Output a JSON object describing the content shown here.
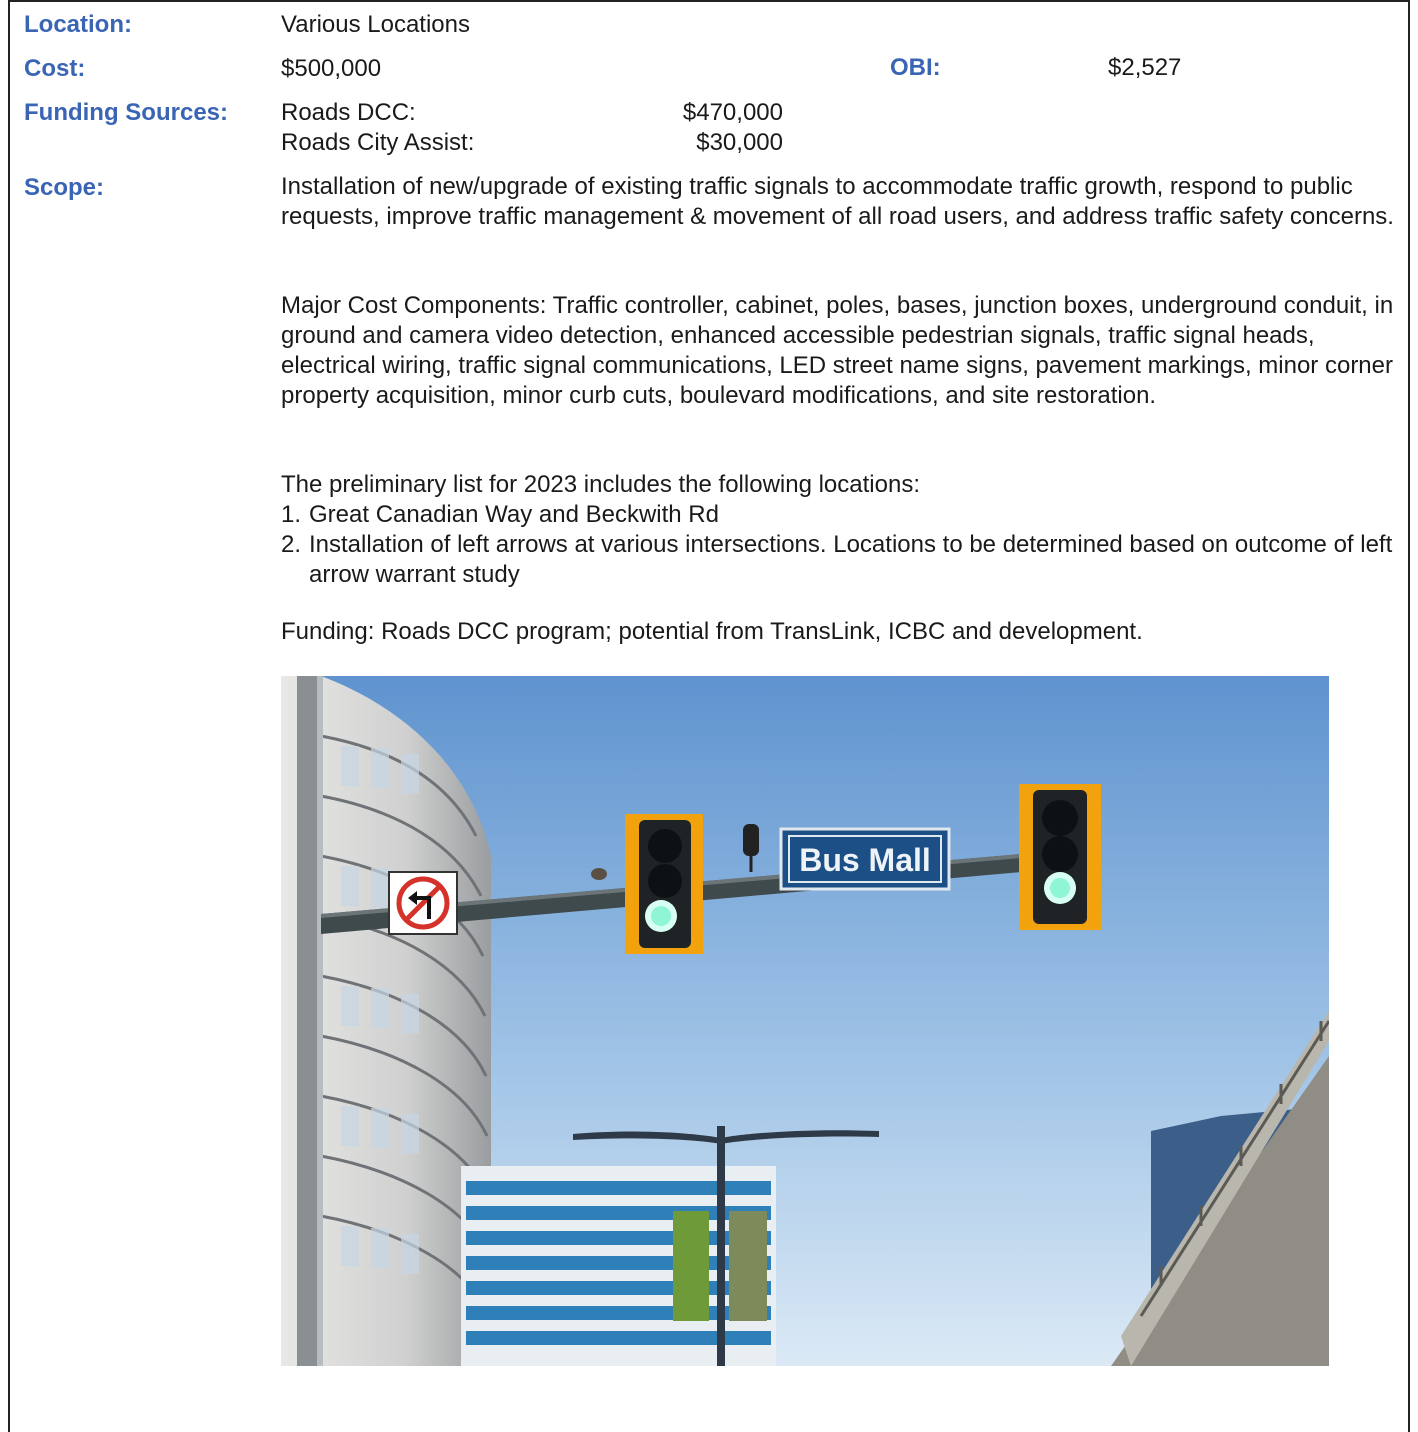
{
  "fields": {
    "location_label": "Location:",
    "location_value": "Various Locations",
    "cost_label": "Cost:",
    "cost_value": "$500,000",
    "obi_label": "OBI:",
    "obi_value": "$2,527",
    "funding_label": "Funding Sources:",
    "funding": [
      {
        "source": "Roads DCC:",
        "amount": "$470,000"
      },
      {
        "source": "Roads City Assist:",
        "amount": "$30,000"
      }
    ],
    "scope_label": "Scope:"
  },
  "scope": {
    "intro": "Installation of new/upgrade of existing traffic signals to accommodate traffic growth, respond to public requests, improve traffic management & movement of all road users, and address traffic safety concerns.",
    "components": "Major Cost Components: Traffic controller, cabinet, poles, bases, junction boxes, underground conduit, in ground and camera video detection, enhanced accessible pedestrian signals, traffic signal heads, electrical wiring, traffic signal communications, LED street name signs, pavement markings, minor corner property acquisition, minor curb cuts, boulevard modifications, and site restoration.",
    "list_intro": "The preliminary list for 2023 includes the following locations:",
    "list": [
      {
        "num": "1.",
        "text": "Great Canadian Way and Beckwith Rd"
      },
      {
        "num": "2.",
        "text": "Installation of left arrows at various intersections. Locations to be determined based on outcome of left arrow warrant study"
      }
    ],
    "funding_note": "Funding: Roads DCC program; potential from TransLink, ICBC and development."
  },
  "photo": {
    "street_sign": "Bus Mall",
    "colors": {
      "label_blue": "#3a64b4",
      "sky_top": "#5f93cf",
      "sky_bottom": "#dbe9f5",
      "signal_backplate": "#f2a20c",
      "sign_blue": "#1c4f86"
    }
  }
}
